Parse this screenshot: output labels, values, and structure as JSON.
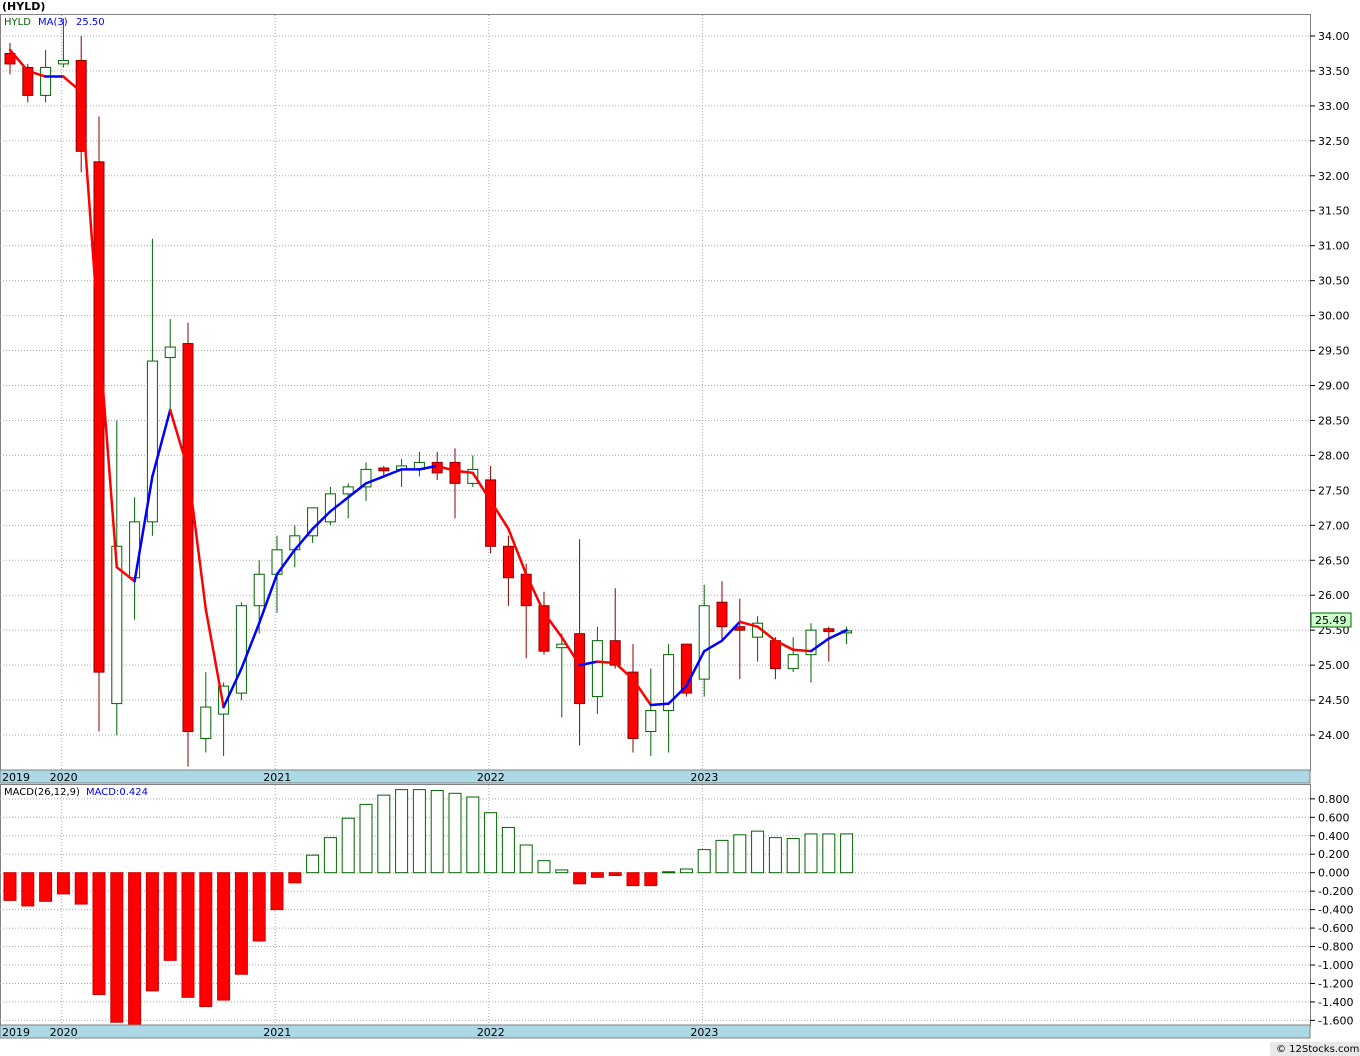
{
  "header": {
    "title": "(HYLD)",
    "price_legend_symbol": "HYLD",
    "price_legend_ma": "MA(3)",
    "price_legend_ma_value": "25.50",
    "macd_legend_name": "MACD(26,12,9)",
    "macd_legend_value": "MACD:0.424",
    "last_price_label": "25.49",
    "watermark": "© 12Stocks.com"
  },
  "colors": {
    "down_candle": "#ff0000",
    "up_candle_border": "#006400",
    "ma_up": "#0000ff",
    "ma_down": "#ff0000",
    "axis_band": "#add8e6",
    "last_price_box": "#ccffcc",
    "grid": "#aaaaaa"
  },
  "chart_data": [
    {
      "type": "candlestick",
      "name": "HYLD",
      "ylim": [
        23.5,
        34.3
      ],
      "yticks": [
        "24.00",
        "24.50",
        "25.00",
        "25.50",
        "26.00",
        "26.50",
        "27.00",
        "27.50",
        "28.00",
        "28.50",
        "29.00",
        "29.50",
        "30.00",
        "30.50",
        "31.00",
        "31.50",
        "32.00",
        "32.50",
        "33.00",
        "33.50",
        "34.00"
      ],
      "x_year_labels": [
        {
          "label": "2019",
          "index": -0.6
        },
        {
          "label": "2020",
          "index": 2.9
        },
        {
          "label": "2021",
          "index": 14.9
        },
        {
          "label": "2022",
          "index": 26.9
        },
        {
          "label": "2023",
          "index": 38.9
        }
      ],
      "year_gridlines": [
        2.9,
        14.9,
        26.9,
        38.9
      ],
      "ma_label": "MA(3)",
      "ma_value": "25.50",
      "last_price": 25.49,
      "candles": [
        {
          "o": 33.75,
          "h": 33.9,
          "l": 33.45,
          "c": 33.6
        },
        {
          "o": 33.55,
          "h": 33.6,
          "l": 33.05,
          "c": 33.15
        },
        {
          "o": 33.15,
          "h": 33.8,
          "l": 33.05,
          "c": 33.55
        },
        {
          "o": 33.6,
          "h": 34.25,
          "l": 33.55,
          "c": 33.65
        },
        {
          "o": 33.65,
          "h": 34.0,
          "l": 32.05,
          "c": 32.35
        },
        {
          "o": 32.2,
          "h": 32.85,
          "l": 24.05,
          "c": 24.9
        },
        {
          "o": 24.45,
          "h": 28.5,
          "l": 24.0,
          "c": 26.7
        },
        {
          "o": 26.25,
          "h": 27.4,
          "l": 25.65,
          "c": 27.05
        },
        {
          "o": 27.05,
          "h": 31.1,
          "l": 26.85,
          "c": 29.35
        },
        {
          "o": 29.4,
          "h": 29.95,
          "l": 28.65,
          "c": 29.55
        },
        {
          "o": 29.6,
          "h": 29.9,
          "l": 23.55,
          "c": 24.05
        },
        {
          "o": 23.95,
          "h": 24.9,
          "l": 23.75,
          "c": 24.4
        },
        {
          "o": 24.3,
          "h": 24.75,
          "l": 23.7,
          "c": 24.7
        },
        {
          "o": 24.6,
          "h": 25.9,
          "l": 24.5,
          "c": 25.85
        },
        {
          "o": 25.85,
          "h": 26.5,
          "l": 25.45,
          "c": 26.3
        },
        {
          "o": 26.3,
          "h": 26.85,
          "l": 25.75,
          "c": 26.65
        },
        {
          "o": 26.65,
          "h": 27.0,
          "l": 26.4,
          "c": 26.85
        },
        {
          "o": 26.85,
          "h": 27.2,
          "l": 26.75,
          "c": 27.25
        },
        {
          "o": 27.05,
          "h": 27.55,
          "l": 27.0,
          "c": 27.45
        },
        {
          "o": 27.45,
          "h": 27.6,
          "l": 27.1,
          "c": 27.55
        },
        {
          "o": 27.55,
          "h": 27.9,
          "l": 27.35,
          "c": 27.8
        },
        {
          "o": 27.82,
          "h": 27.85,
          "l": 27.7,
          "c": 27.78
        },
        {
          "o": 27.8,
          "h": 27.95,
          "l": 27.55,
          "c": 27.85
        },
        {
          "o": 27.8,
          "h": 28.05,
          "l": 27.7,
          "c": 27.9
        },
        {
          "o": 27.9,
          "h": 28.05,
          "l": 27.65,
          "c": 27.75
        },
        {
          "o": 27.9,
          "h": 28.1,
          "l": 27.1,
          "c": 27.6
        },
        {
          "o": 27.6,
          "h": 28.0,
          "l": 27.55,
          "c": 27.8
        },
        {
          "o": 27.65,
          "h": 27.85,
          "l": 26.6,
          "c": 26.7
        },
        {
          "o": 26.7,
          "h": 26.85,
          "l": 25.85,
          "c": 26.25
        },
        {
          "o": 26.3,
          "h": 26.45,
          "l": 25.1,
          "c": 25.85
        },
        {
          "o": 25.85,
          "h": 26.05,
          "l": 25.15,
          "c": 25.2
        },
        {
          "o": 25.25,
          "h": 25.45,
          "l": 24.25,
          "c": 25.3
        },
        {
          "o": 25.45,
          "h": 26.8,
          "l": 23.85,
          "c": 24.45
        },
        {
          "o": 24.55,
          "h": 25.55,
          "l": 24.3,
          "c": 25.35
        },
        {
          "o": 25.35,
          "h": 26.1,
          "l": 24.95,
          "c": 25.0
        },
        {
          "o": 24.9,
          "h": 25.3,
          "l": 23.75,
          "c": 23.95
        },
        {
          "o": 24.05,
          "h": 24.95,
          "l": 23.7,
          "c": 24.35
        },
        {
          "o": 24.35,
          "h": 25.3,
          "l": 23.75,
          "c": 25.15
        },
        {
          "o": 25.3,
          "h": 25.3,
          "l": 24.55,
          "c": 24.6
        },
        {
          "o": 24.8,
          "h": 26.15,
          "l": 24.55,
          "c": 25.85
        },
        {
          "o": 25.9,
          "h": 26.2,
          "l": 25.35,
          "c": 25.55
        },
        {
          "o": 25.55,
          "h": 25.95,
          "l": 24.8,
          "c": 25.5
        },
        {
          "o": 25.4,
          "h": 25.7,
          "l": 25.05,
          "c": 25.6
        },
        {
          "o": 25.35,
          "h": 25.4,
          "l": 24.8,
          "c": 24.95
        },
        {
          "o": 24.95,
          "h": 25.4,
          "l": 24.9,
          "c": 25.15
        },
        {
          "o": 25.15,
          "h": 25.6,
          "l": 24.75,
          "c": 25.5
        },
        {
          "o": 25.52,
          "h": 25.55,
          "l": 25.05,
          "c": 25.48
        },
        {
          "o": 25.49,
          "h": 25.55,
          "l": 25.3,
          "c": 25.49
        }
      ],
      "ma": [
        33.8,
        33.5,
        33.42,
        33.42,
        33.2,
        29.7,
        26.4,
        26.2,
        27.7,
        28.65,
        27.8,
        25.8,
        24.4,
        24.95,
        25.6,
        26.3,
        26.65,
        26.95,
        27.2,
        27.4,
        27.6,
        27.7,
        27.8,
        27.8,
        27.85,
        27.78,
        27.75,
        27.35,
        26.95,
        26.3,
        25.75,
        25.4,
        25.0,
        25.05,
        25.03,
        24.8,
        24.43,
        24.45,
        24.7,
        25.2,
        25.35,
        25.62,
        25.55,
        25.35,
        25.22,
        25.2,
        25.38,
        25.5
      ]
    },
    {
      "type": "bar",
      "name": "MACD(26,12,9)",
      "value_label": "MACD:0.424",
      "ylim": [
        -1.65,
        0.95
      ],
      "yticks": [
        "0.800",
        "0.600",
        "0.400",
        "0.200",
        "0.000",
        "-0.200",
        "-0.400",
        "-0.600",
        "-0.800",
        "-1.000",
        "-1.200",
        "-1.400",
        "-1.600"
      ],
      "values": [
        -0.3,
        -0.36,
        -0.31,
        -0.23,
        -0.34,
        -1.32,
        -1.62,
        -1.68,
        -1.28,
        -0.95,
        -1.35,
        -1.45,
        -1.38,
        -1.1,
        -0.74,
        -0.4,
        -0.11,
        0.19,
        0.38,
        0.59,
        0.74,
        0.84,
        0.9,
        0.9,
        0.89,
        0.86,
        0.82,
        0.65,
        0.49,
        0.3,
        0.13,
        0.03,
        -0.12,
        -0.05,
        -0.03,
        -0.14,
        -0.14,
        0.01,
        0.04,
        0.25,
        0.35,
        0.41,
        0.45,
        0.38,
        0.37,
        0.42,
        0.42,
        0.42
      ]
    }
  ]
}
